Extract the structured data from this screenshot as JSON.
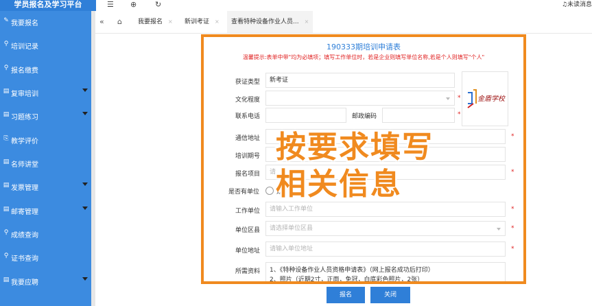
{
  "app": {
    "brand": "学员报名及学习平台",
    "unread": "未读消息"
  },
  "topbar": {
    "menu_icon": "☰",
    "globe_icon": "⊕",
    "refresh_icon": "↻",
    "bell_icon": "♫"
  },
  "sidebar": {
    "items": [
      {
        "label": "我要报名",
        "icon": "✎",
        "icon_name": "pencil-icon",
        "has_arrow": false
      },
      {
        "label": "培训记录",
        "icon": "⚲",
        "icon_name": "search-icon",
        "has_arrow": false
      },
      {
        "label": "报名缴费",
        "icon": "⚲",
        "icon_name": "search-icon",
        "has_arrow": false
      },
      {
        "label": "复审培训",
        "icon": "▤",
        "icon_name": "document-icon",
        "has_arrow": true
      },
      {
        "label": "习题练习",
        "icon": "▤",
        "icon_name": "document-icon",
        "has_arrow": true
      },
      {
        "label": "教学评价",
        "icon": "⎘",
        "icon_name": "clipboard-icon",
        "has_arrow": false
      },
      {
        "label": "名师讲堂",
        "icon": "▤",
        "icon_name": "document-icon",
        "has_arrow": false
      },
      {
        "label": "发票管理",
        "icon": "▤",
        "icon_name": "document-icon",
        "has_arrow": true
      },
      {
        "label": "邮寄管理",
        "icon": "▤",
        "icon_name": "document-icon",
        "has_arrow": true
      },
      {
        "label": "成绩查询",
        "icon": "⚲",
        "icon_name": "search-icon",
        "has_arrow": false
      },
      {
        "label": "证书查询",
        "icon": "⚲",
        "icon_name": "search-icon",
        "has_arrow": false
      },
      {
        "label": "我要应聘",
        "icon": "▤",
        "icon_name": "document-icon",
        "has_arrow": true
      }
    ]
  },
  "tabs": {
    "back_icon": "«",
    "home_icon": "⌂",
    "items": [
      {
        "label": "我要报名"
      },
      {
        "label": "新训考证"
      },
      {
        "label": "查看特种设备作业人员..."
      }
    ],
    "close_glyph": "×"
  },
  "form": {
    "title": "190333期培训申请表",
    "warning": "温馨提示:表单中带\"均为必填项；填写工作单位时，若是企业则填写单位名称,若是个人则填写\"个人\"",
    "required_mark": "*",
    "cert_type": {
      "label": "获证类型",
      "value": "新考证"
    },
    "education": {
      "label": "文化程度",
      "value": ""
    },
    "phone": {
      "label": "联系电话",
      "value": ""
    },
    "postcode": {
      "label": "邮政编码",
      "value": ""
    },
    "address": {
      "label": "通信地址",
      "value": ""
    },
    "training_no": {
      "label": "培训期号",
      "value": ""
    },
    "project": {
      "label": "报名项目",
      "placeholder": "请"
    },
    "has_unit": {
      "label": "是否有单位",
      "option": "是"
    },
    "work_unit": {
      "label": "工作单位",
      "placeholder": "请输入工作单位"
    },
    "unit_area": {
      "label": "单位区县",
      "placeholder": "请选择单位区县"
    },
    "unit_addr": {
      "label": "单位地址",
      "placeholder": "请输入单位地址"
    },
    "materials": {
      "label": "所需资料",
      "line1": "1、《特种设备作业人员资格申请表》（网上报名成功后打印）",
      "line2": "2、照片（近期2寸，正面，免冠，白底彩色照片，2张）"
    },
    "logo_text": "金盾学校"
  },
  "overlay": {
    "line1": "按要求填写",
    "line2": "相关信息"
  },
  "buttons": {
    "submit": "报名",
    "close": "关闭"
  },
  "colors": {
    "primary": "#2f7fd8",
    "sidebar": "#3c8be0",
    "highlight": "#f08a1f",
    "required": "#e02020"
  }
}
